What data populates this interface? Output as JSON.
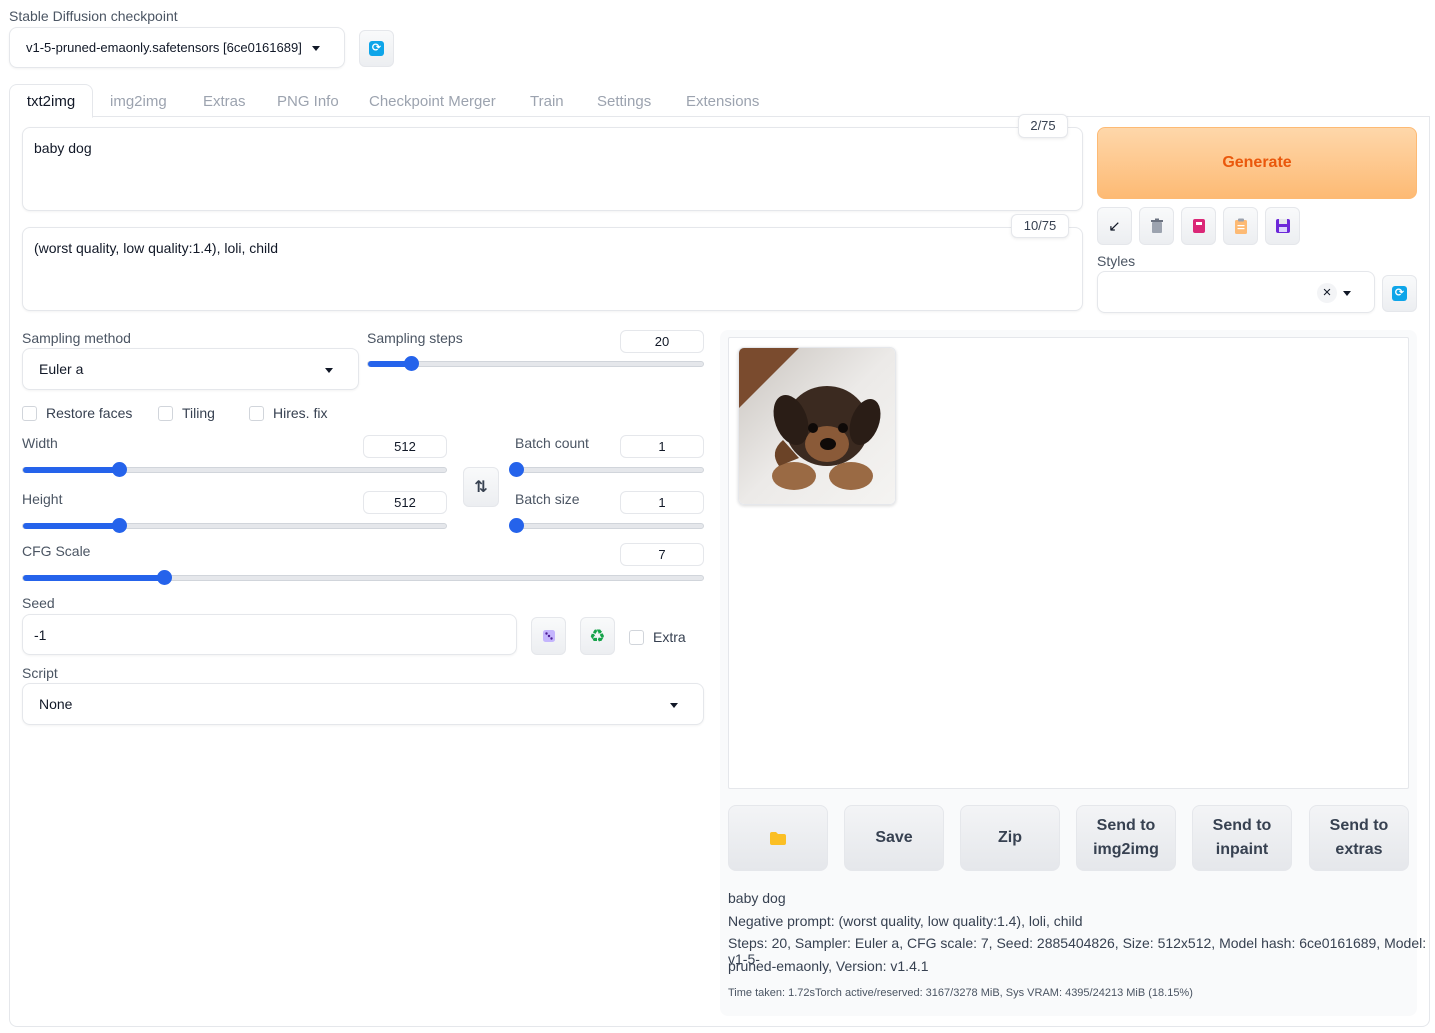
{
  "checkpoint": {
    "label": "Stable Diffusion checkpoint",
    "value": "v1-5-pruned-emaonly.safetensors [6ce0161689]"
  },
  "tabs": [
    "txt2img",
    "img2img",
    "Extras",
    "PNG Info",
    "Checkpoint Merger",
    "Train",
    "Settings",
    "Extensions"
  ],
  "prompt": {
    "value": "baby dog",
    "counter": "2/75"
  },
  "negative_prompt": {
    "value": "(worst quality, low quality:1.4), loli, child",
    "counter": "10/75"
  },
  "generate_label": "Generate",
  "styles": {
    "label": "Styles",
    "value": "",
    "clear": "×"
  },
  "sampling_method": {
    "label": "Sampling method",
    "value": "Euler a"
  },
  "sampling_steps": {
    "label": "Sampling steps",
    "value": "20",
    "min": 1,
    "max": 150,
    "current": 20
  },
  "checkboxes": {
    "restore_faces": "Restore faces",
    "tiling": "Tiling",
    "hires_fix": "Hires. fix",
    "extra": "Extra"
  },
  "width": {
    "label": "Width",
    "value": "512",
    "min": 64,
    "max": 2048,
    "current": 512
  },
  "height": {
    "label": "Height",
    "value": "512",
    "min": 64,
    "max": 2048,
    "current": 512
  },
  "batch_count": {
    "label": "Batch count",
    "value": "1",
    "min": 1,
    "max": 100,
    "current": 1
  },
  "batch_size": {
    "label": "Batch size",
    "value": "1",
    "min": 1,
    "max": 8,
    "current": 1
  },
  "cfg_scale": {
    "label": "CFG Scale",
    "value": "7",
    "min": 1,
    "max": 30,
    "current": 7
  },
  "seed": {
    "label": "Seed",
    "value": "-1"
  },
  "script": {
    "label": "Script",
    "value": "None"
  },
  "output_buttons": {
    "save": "Save",
    "zip": "Zip",
    "send_img2img": "Send to img2img",
    "send_inpaint": "Send to inpaint",
    "send_extras": "Send to extras"
  },
  "info": {
    "prompt": "baby dog",
    "negative": "Negative prompt: (worst quality, low quality:1.4), loli, child",
    "params_1": "Steps: 20, Sampler: Euler a, CFG scale: 7, Seed: 2885404826, Size: 512x512, Model hash: 6ce0161689, Model: v1-5-",
    "params_2": "pruned-emaonly, Version: v1.4.1",
    "time": "Time taken: 1.72sTorch active/reserved: 3167/3278 MiB, Sys VRAM: 4395/24213 MiB (18.15%)"
  },
  "colors": {
    "accent": "#2563eb",
    "generate_bg": "#fdba74",
    "generate_text": "#ea580c"
  }
}
